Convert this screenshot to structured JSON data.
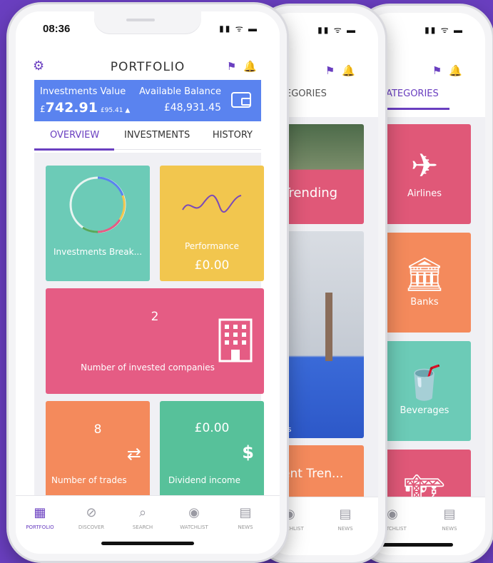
{
  "status": {
    "time": "08:36"
  },
  "header": {
    "title": "PORTFOLIO"
  },
  "balance": {
    "investments_label": "Investments Value",
    "investments_currency": "£",
    "investments_value": "742.91",
    "investments_change": "£95.41 ▲",
    "available_label": "Available Balance",
    "available_value": "£48,931.45"
  },
  "tabs": [
    "OVERVIEW",
    "INVESTMENTS",
    "HISTORY"
  ],
  "tiles": {
    "breakdown": "Investments Break...",
    "performance_label": "Performance",
    "performance_value": "£0.00",
    "companies_value": "2",
    "companies_label": "Number of invested companies",
    "trades_value": "8",
    "trades_label": "Number of trades",
    "dividend_value": "£0.00",
    "dividend_label": "Dividend income"
  },
  "nav": [
    "PORTFOLIO",
    "DISCOVER",
    "SEARCH",
    "WATCHLIST",
    "NEWS"
  ],
  "phone2": {
    "cat_tab": "EGORIES",
    "trending": "Trending",
    "trending2": "ent Tren...",
    "label_small": "es",
    "nav_watch": "WATCHLIST",
    "nav_news": "NEWS"
  },
  "phone3": {
    "cat_tab": "CATEGORIES",
    "airlines": "Airlines",
    "banks": "Banks",
    "beverages": "Beverages",
    "nav_watch": "WATCHLIST",
    "nav_news": "NEWS"
  },
  "colors": {
    "accent": "#6a3fc0",
    "blue": "#5a83ef",
    "teal": "#6ccbb7",
    "yellow": "#f2c64e",
    "pink": "#e55c84",
    "orange": "#f48a5c",
    "green": "#57c19a"
  }
}
